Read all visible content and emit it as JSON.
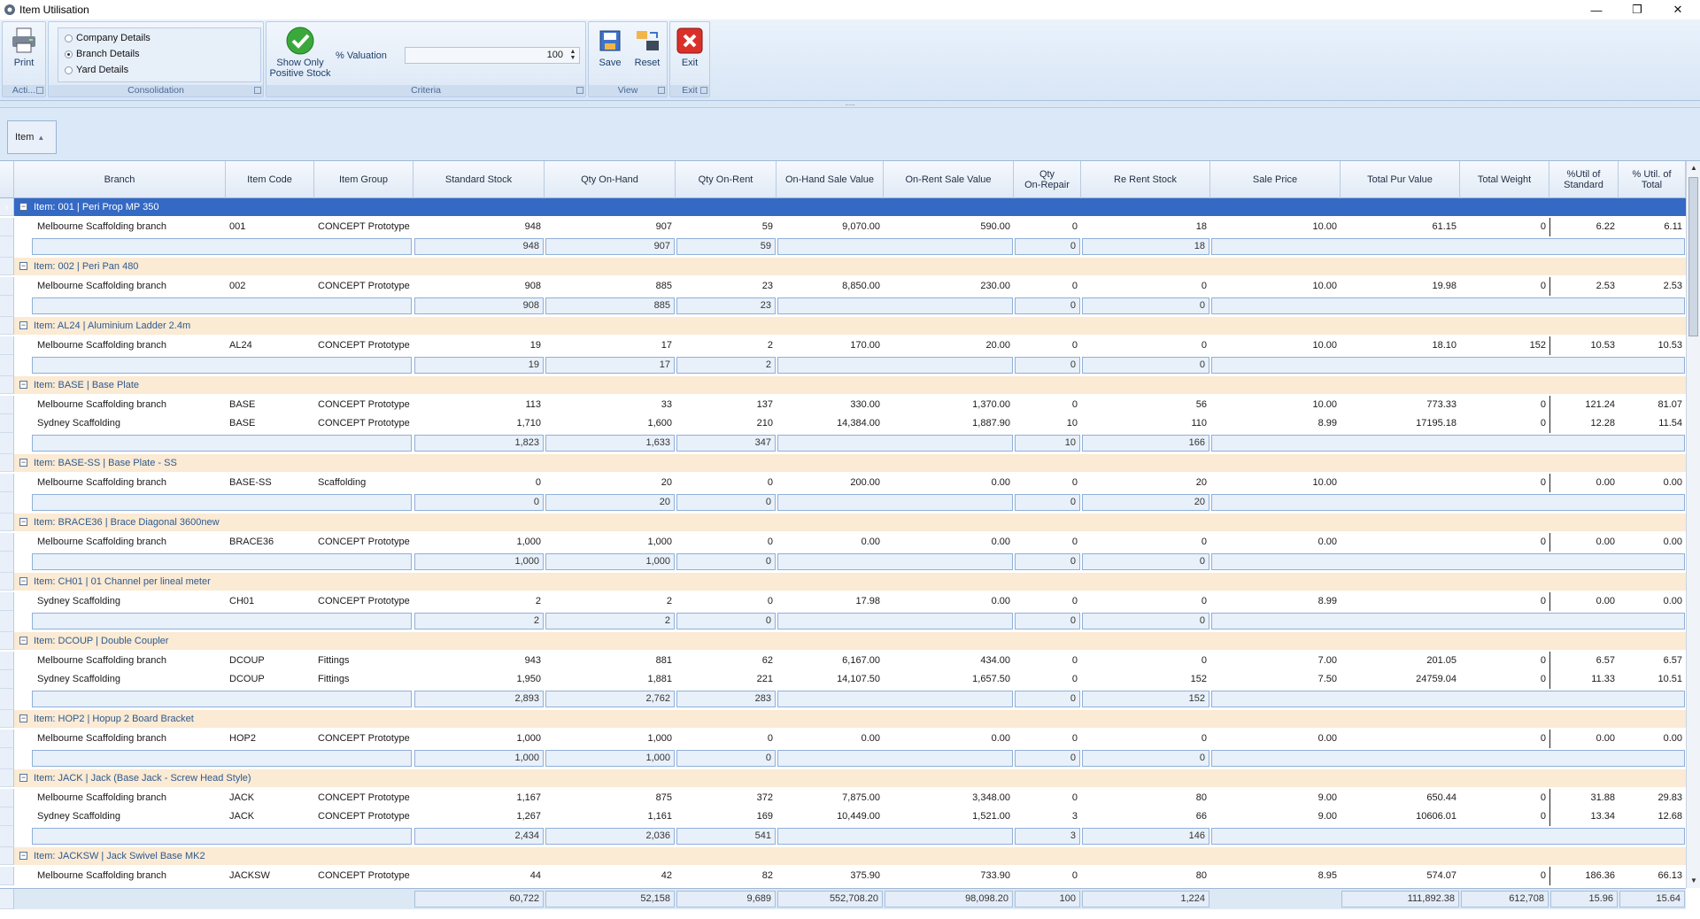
{
  "window": {
    "title": "Item Utilisation",
    "minimize_glyph": "—",
    "restore_glyph": "❐",
    "close_glyph": "✕"
  },
  "ribbon": {
    "actions": {
      "print_label": "Print",
      "caption": "Acti..."
    },
    "consolidation": {
      "caption": "Consolidation",
      "options": [
        "Company Details",
        "Branch Details",
        "Yard Details"
      ],
      "selected": "Branch Details"
    },
    "criteria": {
      "caption": "Criteria",
      "positive_stock_label_1": "Show Only",
      "positive_stock_label_2": "Positive Stock",
      "valuation_label": "% Valuation",
      "valuation_value": "100"
    },
    "view": {
      "caption": "View",
      "save_label": "Save",
      "reset_label": "Reset"
    },
    "exit": {
      "caption": "Exit",
      "exit_label": "Exit"
    }
  },
  "group_panel": {
    "chip_label": "Item",
    "chip_arrow": "▲"
  },
  "columns": [
    "Branch",
    "Item Code",
    "Item Group",
    "Standard Stock",
    "Qty On-Hand",
    "Qty On-Rent",
    "On-Hand Sale Value",
    "On-Rent Sale Value",
    "Qty\nOn-Repair",
    "Re Rent Stock",
    "Sale Price",
    "Total Pur Value",
    "Total Weight",
    "%Util of\nStandard",
    "% Util. of\nTotal"
  ],
  "groups": [
    {
      "label": "Item: 001  |  Peri Prop MP 350",
      "selected": true,
      "rows": [
        [
          "Melbourne Scaffolding branch",
          "001",
          "CONCEPT Prototype",
          "948",
          "907",
          "59",
          "9,070.00",
          "590.00",
          "0",
          "18",
          "10.00",
          "61.15",
          "0",
          "6.22",
          "6.11"
        ]
      ],
      "footer": [
        "948",
        "907",
        "59",
        "0",
        "18"
      ]
    },
    {
      "label": "Item: 002  |  Peri Pan 480",
      "rows": [
        [
          "Melbourne Scaffolding branch",
          "002",
          "CONCEPT Prototype",
          "908",
          "885",
          "23",
          "8,850.00",
          "230.00",
          "0",
          "0",
          "10.00",
          "19.98",
          "0",
          "2.53",
          "2.53"
        ]
      ],
      "footer": [
        "908",
        "885",
        "23",
        "0",
        "0"
      ]
    },
    {
      "label": "Item: AL24  |  Aluminium Ladder 2.4m",
      "rows": [
        [
          "Melbourne Scaffolding branch",
          "AL24",
          "CONCEPT Prototype",
          "19",
          "17",
          "2",
          "170.00",
          "20.00",
          "0",
          "0",
          "10.00",
          "18.10",
          "152",
          "10.53",
          "10.53"
        ]
      ],
      "footer": [
        "19",
        "17",
        "2",
        "0",
        "0"
      ]
    },
    {
      "label": "Item: BASE  |  Base Plate",
      "rows": [
        [
          "Melbourne Scaffolding branch",
          "BASE",
          "CONCEPT Prototype",
          "113",
          "33",
          "137",
          "330.00",
          "1,370.00",
          "0",
          "56",
          "10.00",
          "773.33",
          "0",
          "121.24",
          "81.07"
        ],
        [
          "Sydney Scaffolding",
          "BASE",
          "CONCEPT Prototype",
          "1,710",
          "1,600",
          "210",
          "14,384.00",
          "1,887.90",
          "10",
          "110",
          "8.99",
          "17195.18",
          "0",
          "12.28",
          "11.54"
        ]
      ],
      "footer": [
        "1,823",
        "1,633",
        "347",
        "10",
        "166"
      ]
    },
    {
      "label": "Item: BASE-SS  |  Base Plate - SS",
      "rows": [
        [
          "Melbourne Scaffolding branch",
          "BASE-SS",
          "Scaffolding",
          "0",
          "20",
          "0",
          "200.00",
          "0.00",
          "0",
          "20",
          "10.00",
          "",
          "0",
          "0.00",
          "0.00"
        ]
      ],
      "footer": [
        "0",
        "20",
        "0",
        "0",
        "20"
      ]
    },
    {
      "label": "Item: BRACE36  |  Brace Diagonal 3600new",
      "rows": [
        [
          "Melbourne Scaffolding branch",
          "BRACE36",
          "CONCEPT Prototype",
          "1,000",
          "1,000",
          "0",
          "0.00",
          "0.00",
          "0",
          "0",
          "0.00",
          "",
          "0",
          "0.00",
          "0.00"
        ]
      ],
      "footer": [
        "1,000",
        "1,000",
        "0",
        "0",
        "0"
      ]
    },
    {
      "label": "Item: CH01  |  01 Channel per lineal meter",
      "rows": [
        [
          "Sydney Scaffolding",
          "CH01",
          "CONCEPT Prototype",
          "2",
          "2",
          "0",
          "17.98",
          "0.00",
          "0",
          "0",
          "8.99",
          "",
          "0",
          "0.00",
          "0.00"
        ]
      ],
      "footer": [
        "2",
        "2",
        "0",
        "0",
        "0"
      ]
    },
    {
      "label": "Item: DCOUP  |  Double Coupler",
      "rows": [
        [
          "Melbourne Scaffolding branch",
          "DCOUP",
          "Fittings",
          "943",
          "881",
          "62",
          "6,167.00",
          "434.00",
          "0",
          "0",
          "7.00",
          "201.05",
          "0",
          "6.57",
          "6.57"
        ],
        [
          "Sydney Scaffolding",
          "DCOUP",
          "Fittings",
          "1,950",
          "1,881",
          "221",
          "14,107.50",
          "1,657.50",
          "0",
          "152",
          "7.50",
          "24759.04",
          "0",
          "11.33",
          "10.51"
        ]
      ],
      "footer": [
        "2,893",
        "2,762",
        "283",
        "0",
        "152"
      ]
    },
    {
      "label": "Item: HOP2  |  Hopup 2 Board Bracket",
      "rows": [
        [
          "Melbourne Scaffolding branch",
          "HOP2",
          "CONCEPT Prototype",
          "1,000",
          "1,000",
          "0",
          "0.00",
          "0.00",
          "0",
          "0",
          "0.00",
          "",
          "0",
          "0.00",
          "0.00"
        ]
      ],
      "footer": [
        "1,000",
        "1,000",
        "0",
        "0",
        "0"
      ]
    },
    {
      "label": "Item: JACK  |  Jack (Base Jack - Screw Head Style)",
      "rows": [
        [
          "Melbourne Scaffolding branch",
          "JACK",
          "CONCEPT Prototype",
          "1,167",
          "875",
          "372",
          "7,875.00",
          "3,348.00",
          "0",
          "80",
          "9.00",
          "650.44",
          "0",
          "31.88",
          "29.83"
        ],
        [
          "Sydney Scaffolding",
          "JACK",
          "CONCEPT Prototype",
          "1,267",
          "1,161",
          "169",
          "10,449.00",
          "1,521.00",
          "3",
          "66",
          "9.00",
          "10606.01",
          "0",
          "13.34",
          "12.68"
        ]
      ],
      "footer": [
        "2,434",
        "2,036",
        "541",
        "3",
        "146"
      ]
    },
    {
      "label": "Item: JACKSW  |  Jack Swivel Base MK2",
      "rows": [
        [
          "Melbourne Scaffolding branch",
          "JACKSW",
          "CONCEPT Prototype",
          "44",
          "42",
          "82",
          "375.90",
          "733.90",
          "0",
          "80",
          "8.95",
          "574.07",
          "0",
          "186.36",
          "66.13"
        ]
      ],
      "footer": []
    }
  ],
  "totals": [
    "60,722",
    "52,158",
    "9,689",
    "552,708.20",
    "98,098.20",
    "100",
    "1,224",
    "111,892.38",
    "612,708",
    "15.96",
    "15.64"
  ],
  "icons": {
    "print": "printer-icon",
    "ok": "green-check-icon",
    "save": "save-icon",
    "reset": "reset-icon",
    "exit": "red-x-icon"
  },
  "colors": {
    "group_row": "#fbead4",
    "selected_row": "#3469c4",
    "ribbon": "#dce8f6"
  }
}
